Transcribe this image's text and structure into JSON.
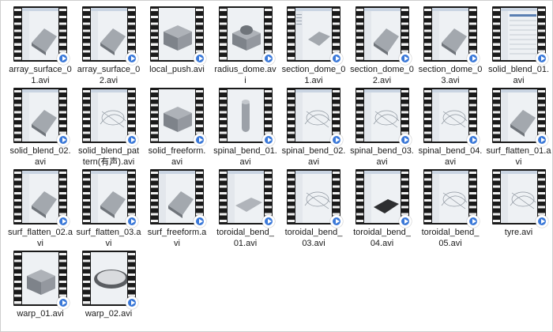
{
  "files": [
    {
      "name": "array_surface_01.avi",
      "line1": "array_surface_0",
      "line2": "1.avi",
      "preview": "ui-shape"
    },
    {
      "name": "array_surface_02.avi",
      "line1": "array_surface_0",
      "line2": "2.avi",
      "preview": "ui-shape"
    },
    {
      "name": "local_push.avi",
      "line1": "local_push.avi",
      "line2": "",
      "preview": "cube"
    },
    {
      "name": "radius_dome.avi",
      "line1": "radius_dome.av",
      "line2": "i",
      "preview": "cube-dome"
    },
    {
      "name": "section_dome_01.avi",
      "line1": "section_dome_0",
      "line2": "1.avi",
      "preview": "ui-panel"
    },
    {
      "name": "section_dome_02.avi",
      "line1": "section_dome_0",
      "line2": "2.avi",
      "preview": "ui-shape"
    },
    {
      "name": "section_dome_03.avi",
      "line1": "section_dome_0",
      "line2": "3.avi",
      "preview": "ui-shape"
    },
    {
      "name": "solid_blend_01.avi",
      "line1": "solid_blend_01.",
      "line2": "avi",
      "preview": "table"
    },
    {
      "name": "solid_blend_02.avi",
      "line1": "solid_blend_02.",
      "line2": "avi",
      "preview": "ui-shape"
    },
    {
      "name": "solid_blend_pattern(有声).avi",
      "line1": "solid_blend_pat",
      "line2": "tern(有声).avi",
      "preview": "ui-wire"
    },
    {
      "name": "solid_freeform.avi",
      "line1": "solid_freeform.",
      "line2": "avi",
      "preview": "cube"
    },
    {
      "name": "spinal_bend_01.avi",
      "line1": "spinal_bend_01.",
      "line2": "avi",
      "preview": "cylinder"
    },
    {
      "name": "spinal_bend_02.avi",
      "line1": "spinal_bend_02.",
      "line2": "avi",
      "preview": "ui-wire"
    },
    {
      "name": "spinal_bend_03.avi",
      "line1": "spinal_bend_03.",
      "line2": "avi",
      "preview": "ui-wire"
    },
    {
      "name": "spinal_bend_04.avi",
      "line1": "spinal_bend_04.",
      "line2": "avi",
      "preview": "ui-wire"
    },
    {
      "name": "surf_flatten_01.avi",
      "line1": "surf_flatten_01.a",
      "line2": "vi",
      "preview": "ui-shape"
    },
    {
      "name": "surf_flatten_02.avi",
      "line1": "surf_flatten_02.a",
      "line2": "vi",
      "preview": "ui-shape"
    },
    {
      "name": "surf_flatten_03.avi",
      "line1": "surf_flatten_03.a",
      "line2": "vi",
      "preview": "ui-shape"
    },
    {
      "name": "surf_freeform.avi",
      "line1": "surf_freeform.a",
      "line2": "vi",
      "preview": "ui-shape"
    },
    {
      "name": "toroidal_bend_01.avi",
      "line1": "toroidal_bend_",
      "line2": "01.avi",
      "preview": "plate"
    },
    {
      "name": "toroidal_bend_03.avi",
      "line1": "toroidal_bend_",
      "line2": "03.avi",
      "preview": "ui-wire"
    },
    {
      "name": "toroidal_bend_04.avi",
      "line1": "toroidal_bend_",
      "line2": "04.avi",
      "preview": "dark-plate"
    },
    {
      "name": "toroidal_bend_05.avi",
      "line1": "toroidal_bend_",
      "line2": "05.avi",
      "preview": "ui-wire"
    },
    {
      "name": "tyre.avi",
      "line1": "tyre.avi",
      "line2": "",
      "preview": "ui-wire"
    },
    {
      "name": "warp_01.avi",
      "line1": "warp_01.avi",
      "line2": "",
      "preview": "cube"
    },
    {
      "name": "warp_02.avi",
      "line1": "warp_02.avi",
      "line2": "",
      "preview": "tray"
    }
  ],
  "colors": {
    "film": "#1a1a1a",
    "play_badge": "#3a78d8",
    "label_text": "#1a1a1a"
  }
}
